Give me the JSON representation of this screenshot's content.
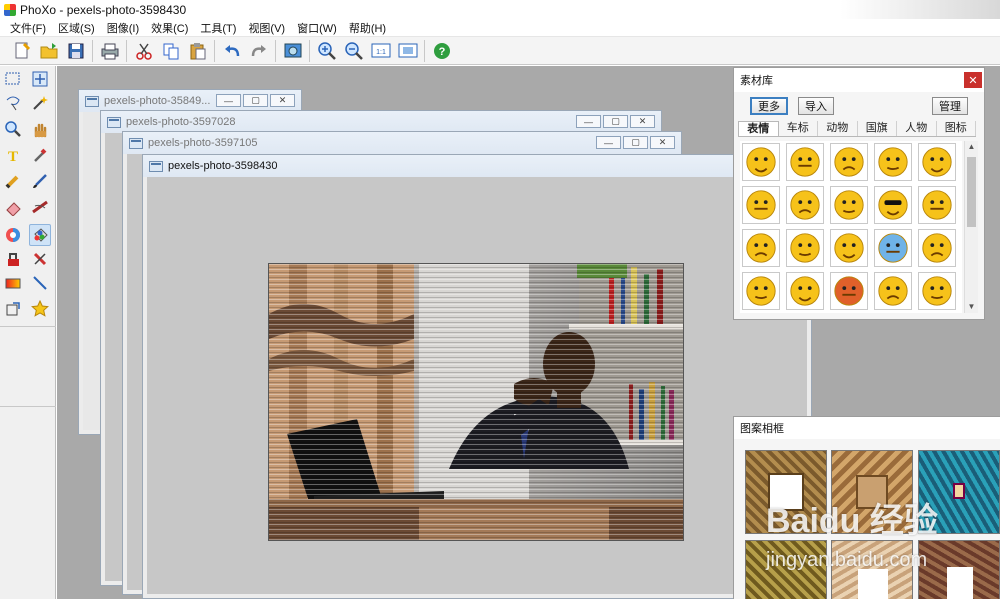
{
  "app": {
    "title": "PhoXo - pexels-photo-3598430"
  },
  "menu": [
    "文件(F)",
    "区域(S)",
    "图像(I)",
    "效果(C)",
    "工具(T)",
    "视图(V)",
    "窗口(W)",
    "帮助(H)"
  ],
  "toolbar": {
    "icons": [
      "new-file-icon",
      "open-folder-icon",
      "save-icon",
      "print-icon",
      "cut-icon",
      "copy-icon",
      "paste-icon",
      "undo-icon",
      "redo-icon",
      "image-settings-icon",
      "zoom-in-icon",
      "zoom-out-icon",
      "actual-size-icon",
      "fit-window-icon",
      "help-icon"
    ]
  },
  "documents": [
    {
      "title": "pexels-photo-35849..."
    },
    {
      "title": "pexels-photo-3597028"
    },
    {
      "title": "pexels-photo-3597105"
    },
    {
      "title": "pexels-photo-3598430"
    }
  ],
  "material_panel": {
    "title": "素材库",
    "buttons": {
      "more": "更多",
      "import": "导入",
      "manage": "管理"
    },
    "tabs": [
      "表情",
      "车标",
      "动物",
      "国旗",
      "人物",
      "图标"
    ],
    "active_tab": "表情",
    "emoticons": [
      "surprised-emoji",
      "screaming-emoji",
      "smirk-emoji",
      "nauseous-emoji",
      "sleepy-emoji",
      "eating-emoji",
      "thinking-emoji",
      "love-emoji",
      "cool-emoji",
      "yawning-emoji",
      "laughing-emoji",
      "annoyed-emoji",
      "angry-emoji",
      "cold-emoji",
      "grinning-teeth-emoji",
      "crying-emoji",
      "frown-emoji",
      "fire-emoji",
      "dizzy-emoji",
      "big-grin-emoji"
    ]
  },
  "frames_panel": {
    "title": "图案相框"
  },
  "watermark": {
    "brand": "Baidu 经验",
    "url": "jingyan.baidu.com"
  },
  "colors": {
    "workspace": "#a9a9a9",
    "active_tool": "#cfe3f7",
    "close": "#c9302c",
    "emoji_yellow": "#f6c21a"
  }
}
